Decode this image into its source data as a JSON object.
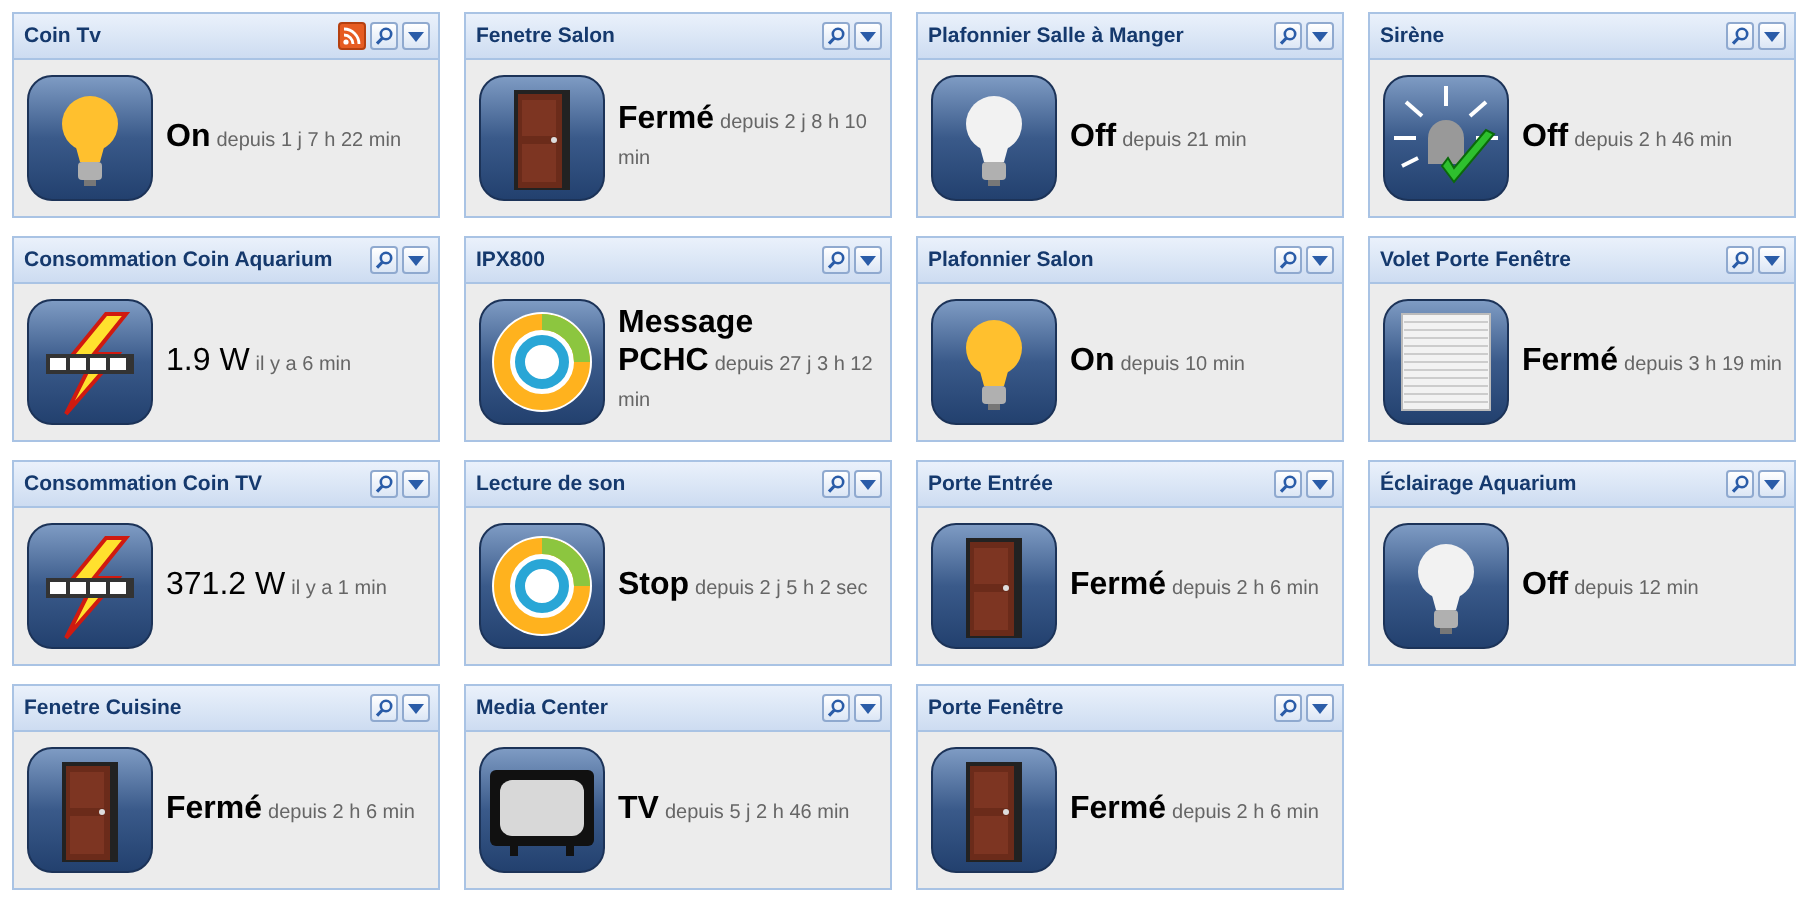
{
  "widgets": [
    {
      "title": "Coin Tv",
      "kind": "bulb_on",
      "value": "On",
      "since": "depuis 1 j 7 h 22 min",
      "rss": true
    },
    {
      "title": "Fenetre Salon",
      "kind": "door",
      "value": "Fermé",
      "since": "depuis 2 j 8 h 10 min",
      "rss": false
    },
    {
      "title": "Plafonnier Salle à Manger",
      "kind": "bulb_off",
      "value": "Off",
      "since": "depuis 21 min",
      "rss": false
    },
    {
      "title": "Sirène",
      "kind": "siren",
      "value": "Off",
      "since": "depuis 2 h 46 min",
      "rss": false
    },
    {
      "title": "Consommation Coin Aquarium",
      "kind": "meter",
      "value": "1.9 W",
      "since": "il y a 6 min",
      "rss": false
    },
    {
      "title": "IPX800",
      "kind": "ring",
      "value": "Message PCHC",
      "since": "depuis 27 j 3 h 12 min",
      "rss": false
    },
    {
      "title": "Plafonnier Salon",
      "kind": "bulb_on",
      "value": "On",
      "since": "depuis 10 min",
      "rss": false
    },
    {
      "title": "Volet Porte Fenêtre",
      "kind": "shutter",
      "value": "Fermé",
      "since": "depuis 3 h 19 min",
      "rss": false
    },
    {
      "title": "Consommation Coin TV",
      "kind": "meter",
      "value": "371.2 W",
      "since": "il y a 1 min",
      "rss": false
    },
    {
      "title": "Lecture de son",
      "kind": "ring",
      "value": "Stop",
      "since": "depuis 2 j 5 h 2 sec",
      "rss": false
    },
    {
      "title": "Porte Entrée",
      "kind": "door",
      "value": "Fermé",
      "since": "depuis 2 h 6 min",
      "rss": false
    },
    {
      "title": "Éclairage Aquarium",
      "kind": "bulb_off",
      "value": "Off",
      "since": "depuis 12 min",
      "rss": false
    },
    {
      "title": "Fenetre Cuisine",
      "kind": "door",
      "value": "Fermé",
      "since": "depuis 2 h 6 min",
      "rss": false
    },
    {
      "title": "Media Center",
      "kind": "tv",
      "value": "TV",
      "since": "depuis 5 j 2 h 46 min",
      "rss": false
    },
    {
      "title": "Porte Fenêtre",
      "kind": "door",
      "value": "Fermé",
      "since": "depuis 2 h 6 min",
      "rss": false
    }
  ]
}
